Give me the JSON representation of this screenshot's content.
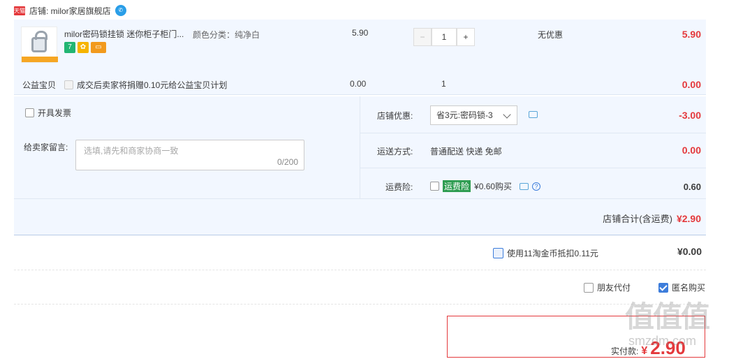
{
  "shop": {
    "badge": "天猫",
    "label": "店铺: milor家居旗舰店",
    "ww_icon": "wangwang-icon"
  },
  "item": {
    "title": "milor密码锁挂锁 迷你柜子柜门...",
    "sku": "颜色分类：纯净白",
    "price": "5.90",
    "qty": "1",
    "promo": "无优惠",
    "subtotal": "5.90",
    "minus": "−",
    "plus": "+"
  },
  "charity": {
    "label": "公益宝贝",
    "text": "成交后卖家将捐赠0.10元给公益宝贝计划",
    "price": "0.00",
    "qty": "1",
    "subtotal": "0.00"
  },
  "invoice": {
    "label": "开具发票"
  },
  "message": {
    "label": "给卖家留言:",
    "placeholder": "选填,请先和商家协商一致",
    "count": "0/200"
  },
  "discount": {
    "label": "店铺优惠:",
    "selected": "省3元:密码锁-3",
    "amount": "-3.00"
  },
  "shipping": {
    "label": "运送方式:",
    "method": "普通配送 快递 免邮",
    "amount": "0.00"
  },
  "insurance": {
    "label": "运费险:",
    "tag": "运费险",
    "text": "¥0.60购买",
    "amount": "0.60"
  },
  "shop_total": {
    "label": "店铺合计(含运费)",
    "amount": "¥2.90"
  },
  "coins": {
    "label": "使用11淘金币抵扣0.11元",
    "amount": "¥0.00"
  },
  "options": {
    "friend_pay": "朋友代付",
    "anonymous": "匿名购买"
  },
  "pay": {
    "label": "实付款:",
    "currency": "¥",
    "amount": "2.90"
  },
  "watermark": {
    "big": "值值值",
    "small": "smzdm.com"
  },
  "colors": {
    "accent": "#e4393c",
    "panel": "#f2f7ff",
    "checkbox": "#3d7ddb",
    "insurance_tag": "#2f9d52"
  }
}
